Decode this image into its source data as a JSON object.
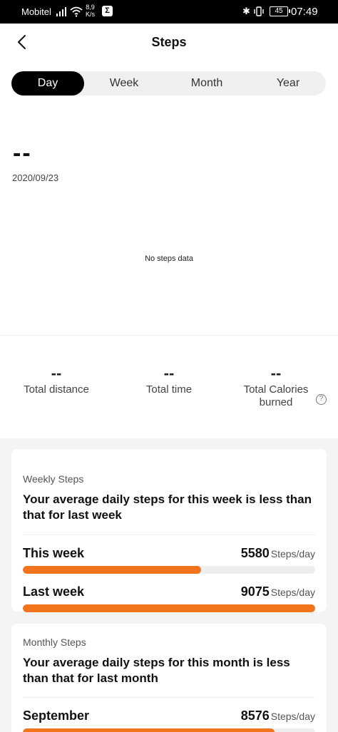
{
  "status_bar": {
    "carrier": "Mobitel",
    "speed_value": "8,9",
    "speed_unit": "K/s",
    "app_glyph": "Σ",
    "battery": "45",
    "time": "07:49"
  },
  "header": {
    "title": "Steps",
    "back_icon": "chevron-left-icon"
  },
  "tabs": [
    {
      "label": "Day",
      "active": true
    },
    {
      "label": "Week",
      "active": false
    },
    {
      "label": "Month",
      "active": false
    },
    {
      "label": "Year",
      "active": false
    }
  ],
  "summary": {
    "value": "--",
    "date": "2020/09/23"
  },
  "chart_data": {
    "type": "bar",
    "empty_message": "No steps data"
  },
  "stats": [
    {
      "value": "--",
      "label": "Total distance"
    },
    {
      "value": "--",
      "label": "Total time"
    },
    {
      "value": "--",
      "label": "Total Calories burned"
    }
  ],
  "weekly": {
    "label": "Weekly Steps",
    "heading": "Your average daily steps for this week is less than that for last week",
    "rows": [
      {
        "name": "This week",
        "value": "5580",
        "unit": "Steps/day",
        "fill": 0.61
      },
      {
        "name": "Last week",
        "value": "9075",
        "unit": "Steps/day",
        "fill": 1.0
      }
    ]
  },
  "monthly": {
    "label": "Monthly Steps",
    "heading": "Your average daily steps for this month is less than that for last month",
    "rows": [
      {
        "name": "September",
        "value": "8576",
        "unit": "Steps/day",
        "fill": 0.86
      }
    ]
  },
  "colors": {
    "accent": "#f2741d",
    "track": "#eeeeee",
    "tab_active": "#000000"
  }
}
